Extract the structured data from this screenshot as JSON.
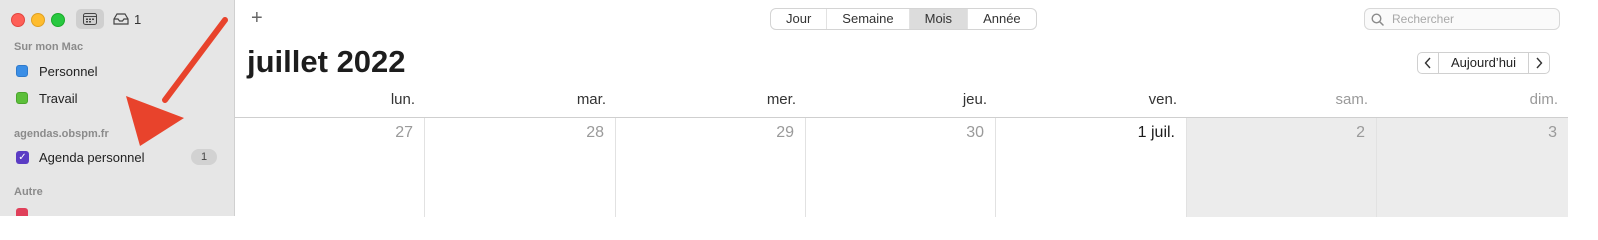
{
  "sidebar": {
    "inbox_count": "1",
    "sections": [
      {
        "title": "Sur mon Mac"
      },
      {
        "title": "agendas.obspm.fr"
      },
      {
        "title": "Autre"
      }
    ],
    "calendars": [
      {
        "label": "Personnel",
        "color": "#3a8ee6"
      },
      {
        "label": "Travail",
        "color": "#5cbf3a"
      },
      {
        "label": "Agenda personnel",
        "color": "#5b3cc4",
        "count": "1"
      }
    ]
  },
  "toolbar": {
    "add_label": "+",
    "views": [
      "Jour",
      "Semaine",
      "Mois",
      "Année"
    ],
    "active_view": "Mois",
    "search_placeholder": "Rechercher"
  },
  "header": {
    "month_title": "juillet 2022",
    "prev_label": "<",
    "today_label": "Aujourd’hui",
    "next_label": ">"
  },
  "calendar": {
    "weekdays": [
      "lun.",
      "mar.",
      "mer.",
      "jeu.",
      "ven.",
      "sam.",
      "dim."
    ],
    "days": [
      "27",
      "28",
      "29",
      "30",
      "1 juil.",
      "2",
      "3"
    ]
  },
  "annotation": {
    "arrow_color": "#e8432c"
  }
}
